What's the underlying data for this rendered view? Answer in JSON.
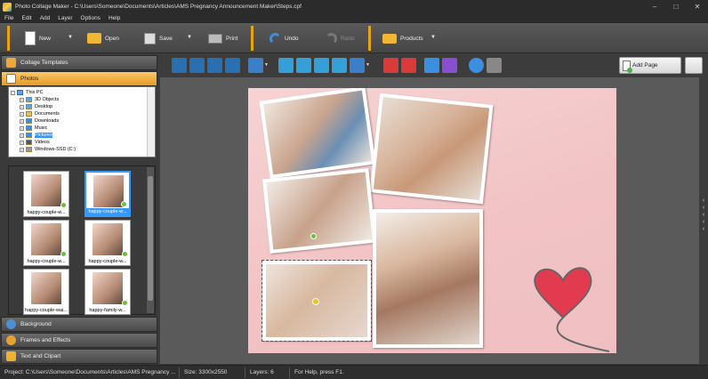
{
  "window": {
    "title": "Photo Collage Maker - C:\\Users\\Someone\\Documents\\Articles\\AMS Pregnancy Announcement Maker\\Steps.cpf"
  },
  "menu": [
    "File",
    "Edit",
    "Add",
    "Layer",
    "Options",
    "Help"
  ],
  "toolbar": {
    "new_label": "New",
    "open_label": "Open",
    "save_label": "Save",
    "print_label": "Print",
    "undo_label": "Undo",
    "redo_label": "Redo",
    "products_label": "Products"
  },
  "left_panel": {
    "collage_templates": "Collage Templates",
    "photos": "Photos",
    "background": "Background",
    "frames_effects": "Frames and Effects",
    "text_clipart": "Text and Clipart"
  },
  "tree": {
    "items": [
      {
        "label": "This PC"
      },
      {
        "label": "3D Objects"
      },
      {
        "label": "Desktop"
      },
      {
        "label": "Documents"
      },
      {
        "label": "Downloads"
      },
      {
        "label": "Music"
      },
      {
        "label": "Pictures"
      },
      {
        "label": "Videos"
      },
      {
        "label": "Windows-SSD (C:)"
      }
    ]
  },
  "thumbnails": [
    {
      "caption": "happy-couple-w..."
    },
    {
      "caption": "happy-couple-w..."
    },
    {
      "caption": "happy-couple-w..."
    },
    {
      "caption": "happy-couple-w..."
    },
    {
      "caption": "happy-couple-wai..."
    },
    {
      "caption": "happy-family-w..."
    }
  ],
  "add_page_label": "Add Page",
  "statusbar": {
    "project": "Project: C:\\Users\\Someone\\Documents\\Articles\\AMS Pregnancy ...",
    "size": "Size: 3300x2550",
    "layers": "Layers: 6",
    "help": "For Help, press F1."
  },
  "colors": {
    "accent": "#e8a40b",
    "selection": "#3399ff",
    "canvas_bg": "#f4c9ca",
    "heart": "#e23a4f"
  }
}
